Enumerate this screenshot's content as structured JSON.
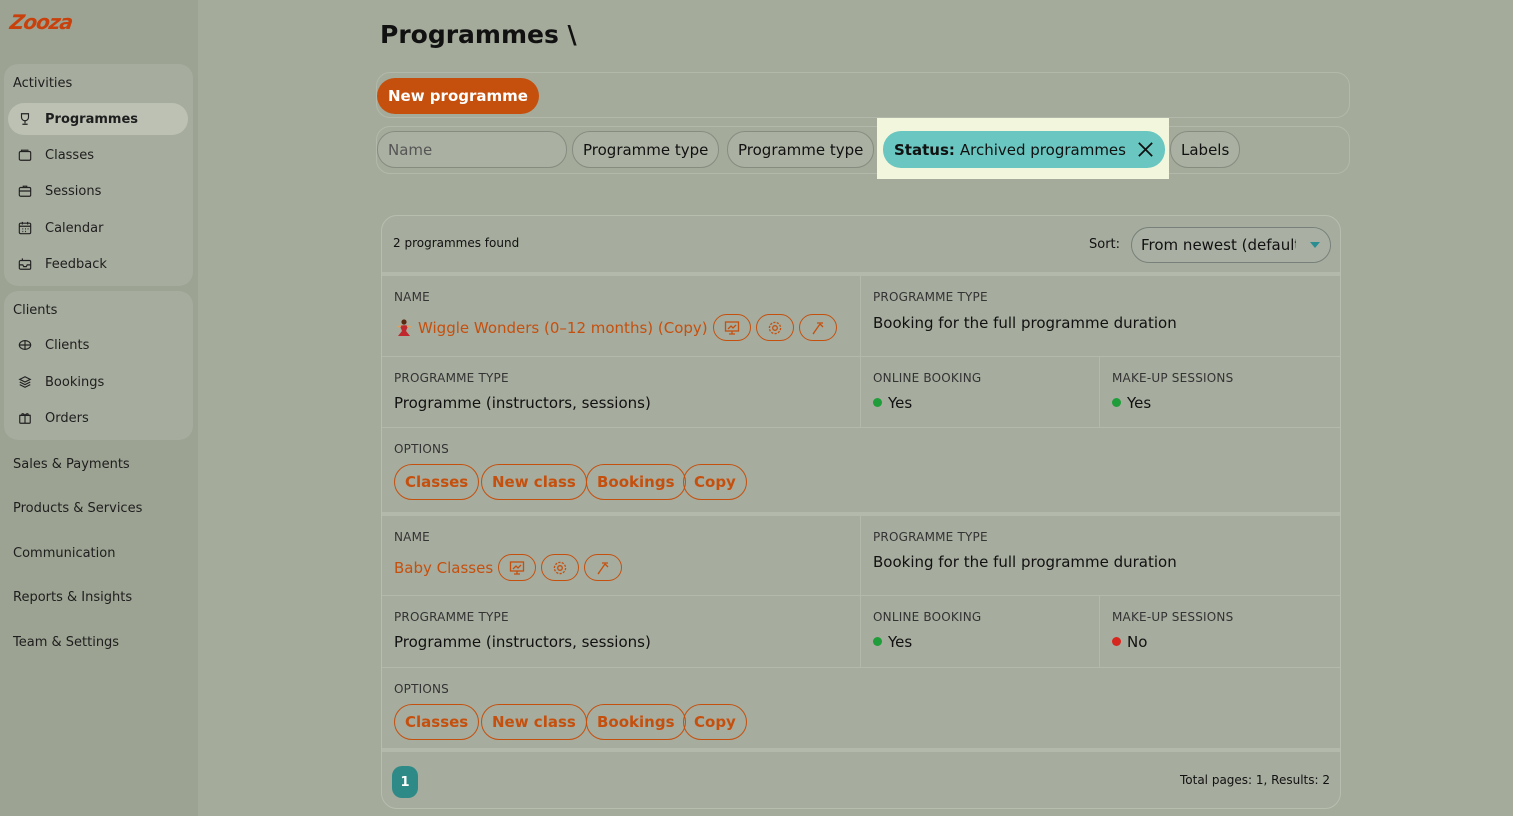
{
  "sidebar": {
    "logo": "Zooza",
    "groups": [
      {
        "title": "Activities",
        "items": [
          {
            "label": "Programmes",
            "icon": "trophy-icon",
            "active": true
          },
          {
            "label": "Classes",
            "icon": "folder-icon"
          },
          {
            "label": "Sessions",
            "icon": "briefcase-icon"
          },
          {
            "label": "Calendar",
            "icon": "calendar-icon"
          },
          {
            "label": "Feedback",
            "icon": "inbox-icon"
          }
        ]
      },
      {
        "title": "Clients",
        "items": [
          {
            "label": "Clients",
            "icon": "users-icon"
          },
          {
            "label": "Bookings",
            "icon": "layers-icon"
          },
          {
            "label": "Orders",
            "icon": "gift-icon"
          }
        ]
      }
    ],
    "top_items": [
      "Sales & Payments",
      "Products & Services",
      "Communication",
      "Reports & Insights",
      "Team & Settings"
    ]
  },
  "page": {
    "title": "Programmes \\",
    "new_button": "New programme"
  },
  "filters": {
    "name_placeholder": "Name",
    "pills": [
      "Programme type",
      "Programme type"
    ],
    "status_key": "Status:",
    "status_value": "Archived programmes",
    "labels": "Labels"
  },
  "results": {
    "count": "2 programmes found",
    "sort_label": "Sort:",
    "sort_value": "From newest (default)",
    "programmes": [
      {
        "name_label": "NAME",
        "name": "Wiggle Wonders (0–12 months) (Copy)",
        "has_emoji": true,
        "type_label": "PROGRAMME TYPE",
        "type_value": "Booking for the full programme duration",
        "ptype_label": "PROGRAMME TYPE",
        "ptype_value": "Programme (instructors, sessions)",
        "online_label": "ONLINE BOOKING",
        "online_value": "Yes",
        "online_color": "#1f9d3a",
        "makeup_label": "MAKE-UP SESSIONS",
        "makeup_value": "Yes",
        "makeup_color": "#1f9d3a",
        "options_label": "OPTIONS",
        "options": [
          "Classes",
          "New class",
          "Bookings",
          "Copy"
        ]
      },
      {
        "name_label": "NAME",
        "name": "Baby Classes",
        "has_emoji": false,
        "type_label": "PROGRAMME TYPE",
        "type_value": "Booking for the full programme duration",
        "ptype_label": "PROGRAMME TYPE",
        "ptype_value": "Programme (instructors, sessions)",
        "online_label": "ONLINE BOOKING",
        "online_value": "Yes",
        "online_color": "#1f9d3a",
        "makeup_label": "MAKE-UP SESSIONS",
        "makeup_value": "No",
        "makeup_color": "#d7261e",
        "options_label": "OPTIONS",
        "options": [
          "Classes",
          "New class",
          "Bookings",
          "Copy"
        ]
      }
    ],
    "page_number": "1",
    "totals": "Total pages: 1, Results: 2"
  },
  "colors": {
    "accent": "#c5500e",
    "status_pill": "#69c6c0",
    "pager": "#2e8a86"
  }
}
